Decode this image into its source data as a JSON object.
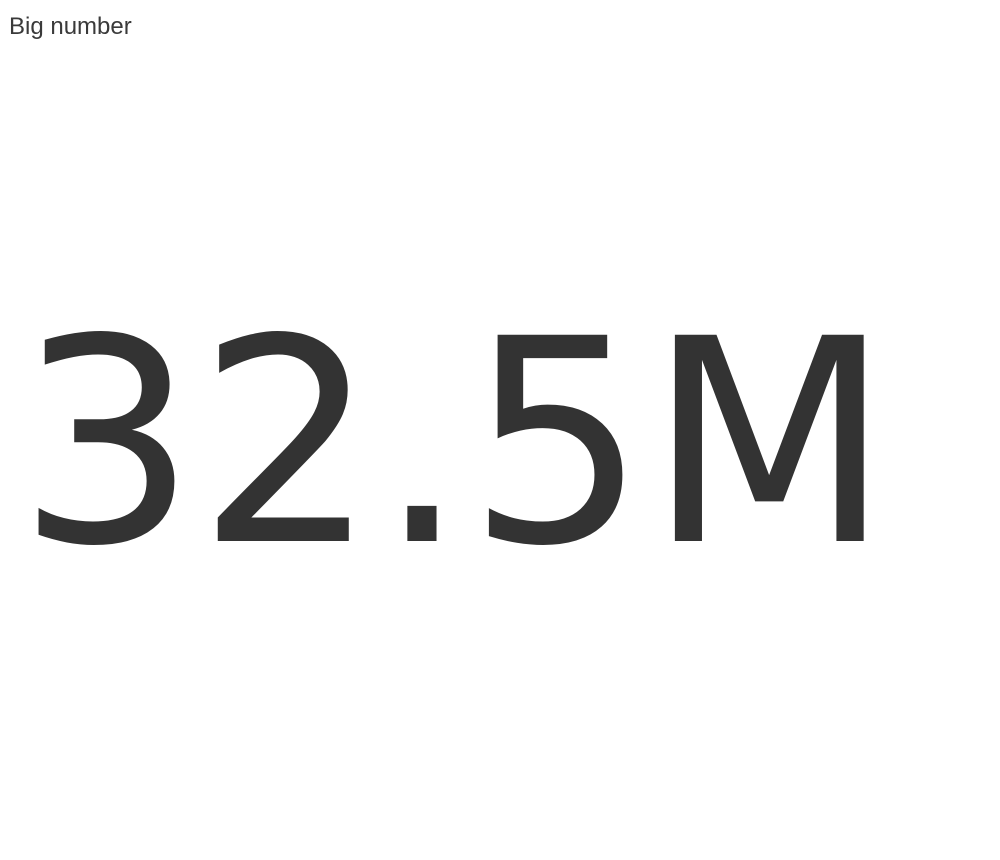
{
  "widget": {
    "title": "Big number",
    "value": "32.5M"
  },
  "colors": {
    "text": "#333333",
    "background": "#ffffff"
  }
}
